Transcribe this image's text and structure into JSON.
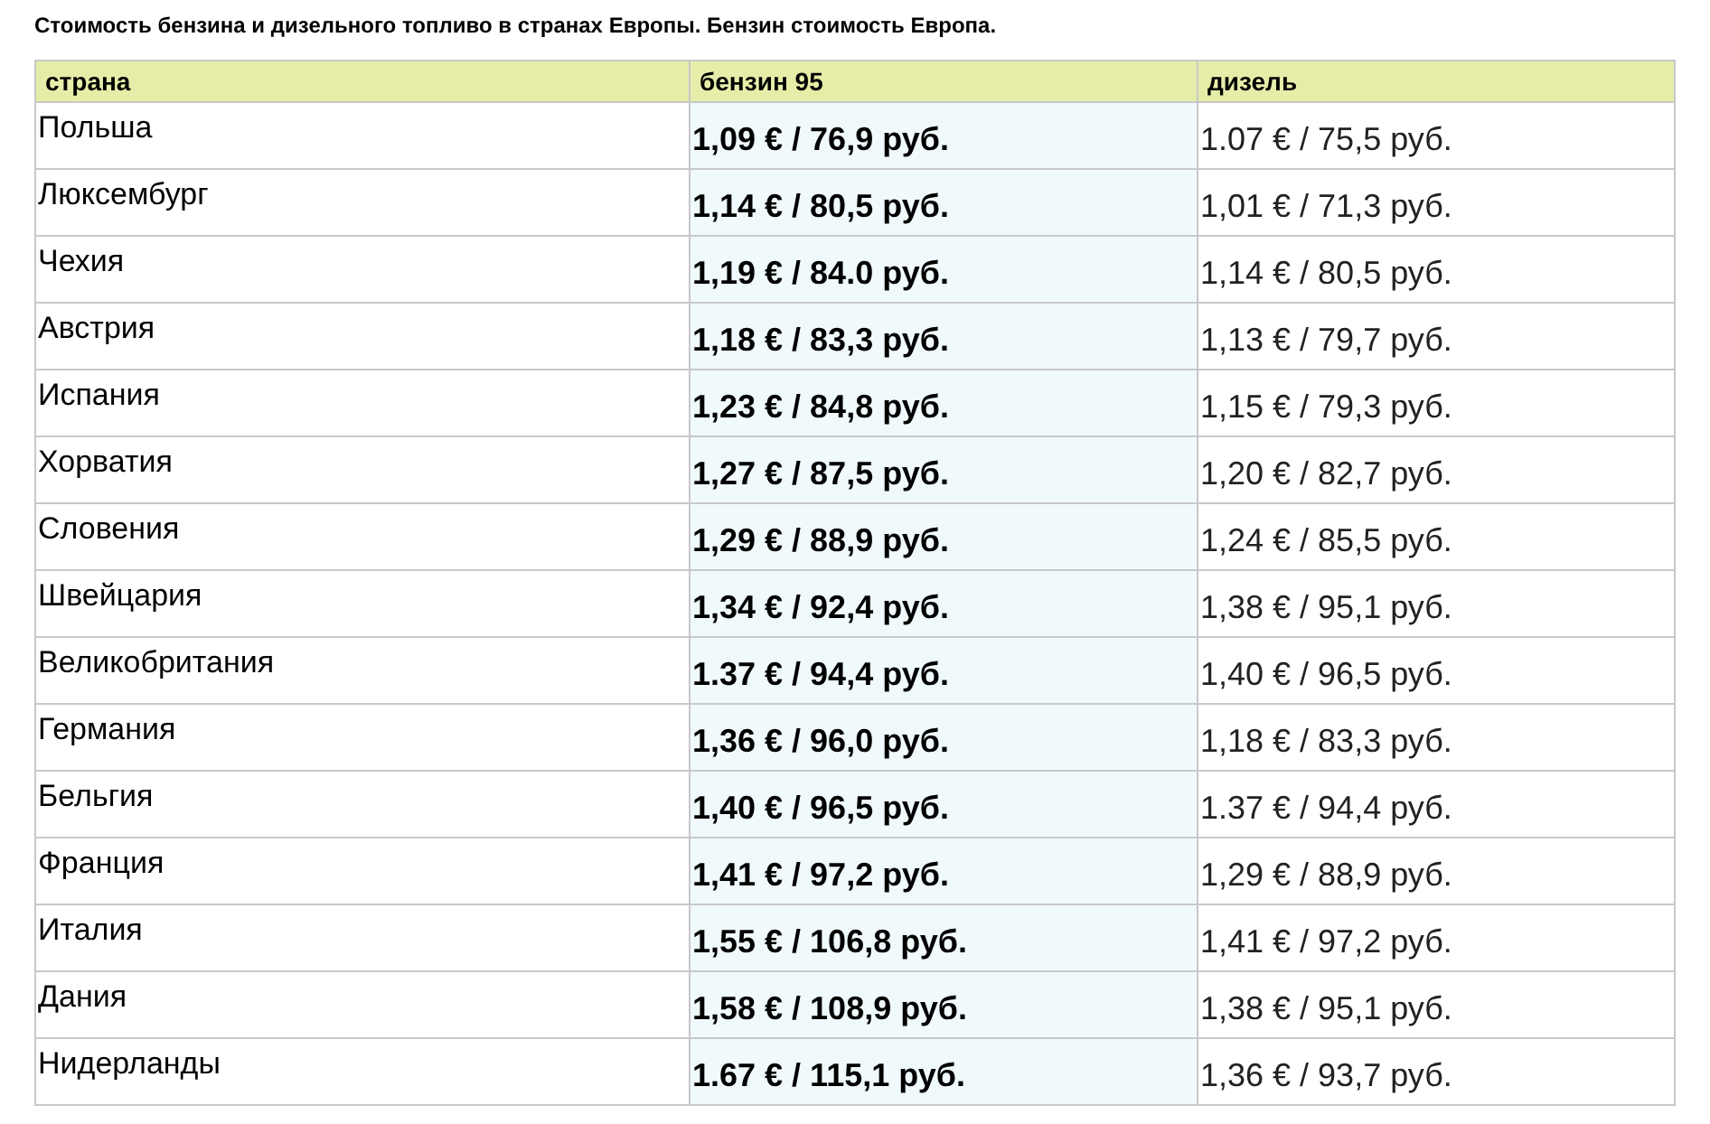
{
  "title": "Стоимость бензина и дизельного топливо в странах Европы. Бензин стоимость Европа.",
  "table": {
    "columns": [
      "страна",
      "бензин 95",
      "дизель"
    ],
    "rows": [
      [
        "Польша",
        "1,09 € / 76,9 руб.",
        "1.07 € / 75,5 руб."
      ],
      [
        "Люксембург",
        "1,14 € / 80,5 руб.",
        "1,01 € / 71,3 руб."
      ],
      [
        "Чехия",
        "1,19 € / 84.0 руб.",
        "1,14 € / 80,5 руб."
      ],
      [
        "Австрия",
        "1,18 € / 83,3 руб.",
        "1,13 € / 79,7 руб."
      ],
      [
        "Испания",
        "1,23 € / 84,8 руб.",
        "1,15 € / 79,3 руб."
      ],
      [
        "Хорватия",
        "1,27 € / 87,5 руб.",
        "1,20 € / 82,7 руб."
      ],
      [
        "Словения",
        "1,29 € / 88,9 руб.",
        "1,24 € / 85,5 руб."
      ],
      [
        "Швейцария",
        "1,34 € / 92,4 руб.",
        "1,38 € / 95,1 руб."
      ],
      [
        "Великобритания",
        "1.37 € / 94,4 руб.",
        "1,40 € / 96,5 руб."
      ],
      [
        "Германия",
        "1,36 € / 96,0 руб.",
        "1,18 € / 83,3 руб."
      ],
      [
        "Бельгия",
        "1,40 € / 96,5 руб.",
        "1.37 € / 94,4 руб."
      ],
      [
        "Франция",
        "1,41 € / 97,2 руб.",
        "1,29 € / 88,9 руб."
      ],
      [
        "Италия",
        "1,55 € / 106,8 руб.",
        "1,41 € / 97,2 руб."
      ],
      [
        "Дания",
        "1,58 € / 108,9 руб.",
        "1,38 € / 95,1 руб."
      ],
      [
        "Нидерланды",
        "1.67 € / 115,1 руб.",
        "1,36 € / 93,7 руб."
      ]
    ]
  }
}
